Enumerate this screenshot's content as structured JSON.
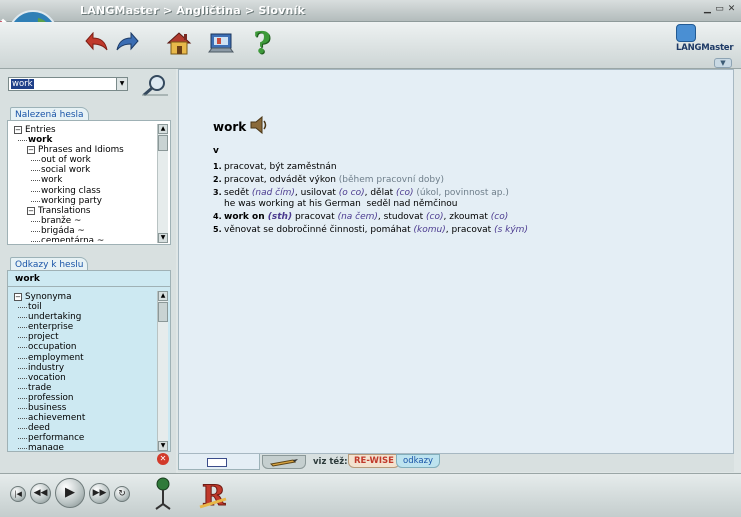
{
  "window": {
    "title": "LANGMaster > Angličtina > Slovník",
    "brand": "LANGMaster"
  },
  "search": {
    "value": "work"
  },
  "found_panel": {
    "tab": "Nalezená hesla",
    "tree": [
      {
        "text": "Entries",
        "level": 0,
        "expander": true,
        "bold": false
      },
      {
        "text": "work",
        "level": 1,
        "expander": false,
        "bold": true
      },
      {
        "text": "Phrases and Idioms",
        "level": 1,
        "expander": true,
        "bold": false
      },
      {
        "text": "out of work",
        "level": 2,
        "expander": false,
        "bold": false
      },
      {
        "text": "social work",
        "level": 2,
        "expander": false,
        "bold": false
      },
      {
        "text": "work",
        "level": 2,
        "expander": false,
        "bold": false
      },
      {
        "text": "working class",
        "level": 2,
        "expander": false,
        "bold": false
      },
      {
        "text": "working party",
        "level": 2,
        "expander": false,
        "bold": false
      },
      {
        "text": "Translations",
        "level": 1,
        "expander": true,
        "bold": false
      },
      {
        "text": "branže ~",
        "level": 2,
        "expander": false,
        "bold": false
      },
      {
        "text": "brigáda ~",
        "level": 2,
        "expander": false,
        "bold": false
      },
      {
        "text": "cementárna ~",
        "level": 2,
        "expander": false,
        "bold": false
      }
    ]
  },
  "links_panel": {
    "tab": "Odkazy k heslu",
    "headword": "work",
    "tree": [
      {
        "text": "Synonyma",
        "level": 0,
        "expander": true
      },
      {
        "text": "toil",
        "level": 1,
        "expander": false
      },
      {
        "text": "undertaking",
        "level": 1,
        "expander": false
      },
      {
        "text": "enterprise",
        "level": 1,
        "expander": false
      },
      {
        "text": "project",
        "level": 1,
        "expander": false
      },
      {
        "text": "occupation",
        "level": 1,
        "expander": false
      },
      {
        "text": "employment",
        "level": 1,
        "expander": false
      },
      {
        "text": "industry",
        "level": 1,
        "expander": false
      },
      {
        "text": "vocation",
        "level": 1,
        "expander": false
      },
      {
        "text": "trade",
        "level": 1,
        "expander": false
      },
      {
        "text": "profession",
        "level": 1,
        "expander": false
      },
      {
        "text": "business",
        "level": 1,
        "expander": false
      },
      {
        "text": "achievement",
        "level": 1,
        "expander": false
      },
      {
        "text": "deed",
        "level": 1,
        "expander": false
      },
      {
        "text": "performance",
        "level": 1,
        "expander": false
      },
      {
        "text": "manage",
        "level": 1,
        "expander": false
      }
    ]
  },
  "entry": {
    "headword": "work",
    "pos": "v",
    "senses": [
      {
        "num": "1.",
        "parts": [
          {
            "t": "pracovat, být zaměstnán",
            "s": "n"
          }
        ]
      },
      {
        "num": "2.",
        "parts": [
          {
            "t": "pracovat, odvádět výkon ",
            "s": "n"
          },
          {
            "t": "(během pracovní doby)",
            "s": "g"
          }
        ]
      },
      {
        "num": "3.",
        "parts": [
          {
            "t": "sedět ",
            "s": "n"
          },
          {
            "t": "(nad čím)",
            "s": "i"
          },
          {
            "t": ", usilovat ",
            "s": "n"
          },
          {
            "t": "(o co)",
            "s": "i"
          },
          {
            "t": ", dělat ",
            "s": "n"
          },
          {
            "t": "(co)",
            "s": "i"
          },
          {
            "t": " (úkol, povinnost ap.)",
            "s": "g"
          }
        ],
        "example": "he was working at his German  seděl nad němčinou"
      },
      {
        "num": "4.",
        "parts": [
          {
            "t": "work on ",
            "s": "b"
          },
          {
            "t": "(sth)",
            "s": "bi"
          },
          {
            "t": " pracovat ",
            "s": "n"
          },
          {
            "t": "(na čem)",
            "s": "i"
          },
          {
            "t": ", studovat ",
            "s": "n"
          },
          {
            "t": "(co)",
            "s": "i"
          },
          {
            "t": ", zkoumat ",
            "s": "n"
          },
          {
            "t": "(co)",
            "s": "i"
          }
        ]
      },
      {
        "num": "5.",
        "parts": [
          {
            "t": "věnovat se dobročinné činnosti, pomáhat ",
            "s": "n"
          },
          {
            "t": "(komu)",
            "s": "i"
          },
          {
            "t": ", pracovat ",
            "s": "n"
          },
          {
            "t": "(s kým)",
            "s": "i"
          }
        ]
      }
    ]
  },
  "see_also": {
    "label": "viz též:",
    "rewise": "RE-WISE",
    "odkazy": "odkazy"
  },
  "icons": [
    "globe-flag-logo",
    "back-arrow-icon",
    "forward-arrow-icon",
    "home-icon",
    "computer-book-icon",
    "help-icon",
    "search-icon",
    "speaker-icon",
    "close-icon",
    "note-icon",
    "pencil-icon",
    "rewind-start-icon",
    "rewind-icon",
    "play-icon",
    "fast-forward-icon",
    "repeat-icon",
    "microphone-icon",
    "rewise-icon"
  ],
  "colors": {
    "content_bg": "#e4eef5",
    "panel_bg": "#d8e0e0",
    "link_blue": "#1a55a8",
    "italic_purple": "#4b3a8f",
    "rewise_red": "#c0392b"
  }
}
